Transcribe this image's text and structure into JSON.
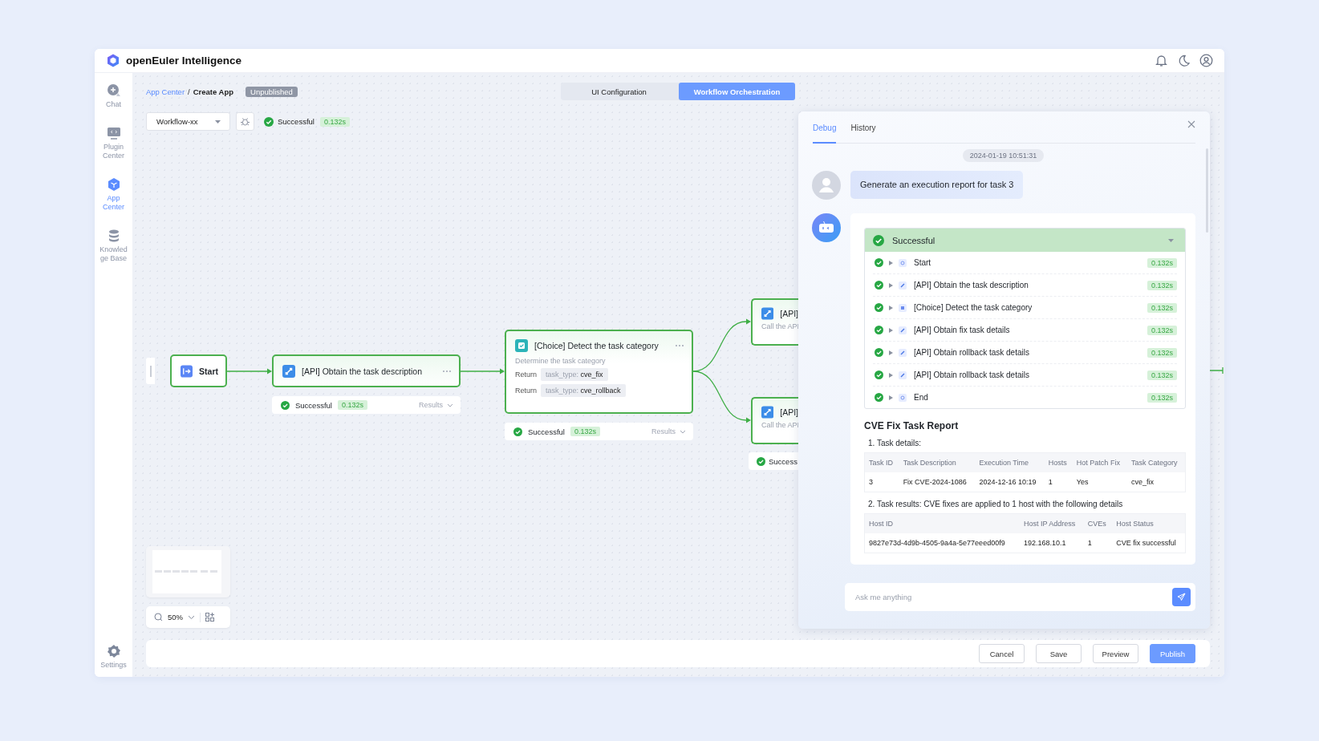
{
  "app": {
    "title": "openEuler Intelligence"
  },
  "sidebar": {
    "items": [
      {
        "label": "Chat",
        "kind": "chat",
        "selected": false
      },
      {
        "label": "Plugin Center",
        "kind": "plugin",
        "selected": false
      },
      {
        "label": "App Center",
        "kind": "app",
        "selected": true
      },
      {
        "label": "Knowledge Base",
        "kind": "knowledge",
        "selected": false
      }
    ],
    "settings": {
      "label": "Settings"
    }
  },
  "breadcrumb": {
    "items": [
      "App Center",
      "Create App"
    ],
    "separator": "/",
    "badge": "Unpublished"
  },
  "tabs": [
    {
      "label": "UI Configuration",
      "selected": false
    },
    {
      "label": "Workflow Orchestration",
      "selected": true
    }
  ],
  "toolbar": {
    "workflow": "Workflow-xx",
    "status": "Successful",
    "time": "0.132s"
  },
  "canvas": {
    "nodes": [
      {
        "kind": "start",
        "title": "Start"
      },
      {
        "kind": "api",
        "title": "[API] Obtain the task description",
        "status": {
          "text": "Successful",
          "time": "0.132s",
          "results": "Results"
        }
      },
      {
        "kind": "choice",
        "title": "[Choice] Detect the task category",
        "description": "Determine the task category",
        "returns": [
          {
            "label": "Return",
            "key": "task_type:",
            "value": "cve_fix"
          },
          {
            "label": "Return",
            "key": "task_type:",
            "value": "cve_rollback"
          }
        ],
        "status": {
          "text": "Successful",
          "time": "0.132s",
          "results": "Results"
        }
      },
      {
        "kind": "api",
        "title": "[API]",
        "description": "Call the API"
      },
      {
        "kind": "api",
        "title": "[API]",
        "description": "Call the API",
        "status": {
          "text": "Success"
        }
      }
    ],
    "zoom": "50%"
  },
  "debug_panel": {
    "tabs": [
      {
        "label": "Debug",
        "selected": true
      },
      {
        "label": "History",
        "selected": false
      }
    ],
    "timestamp": "2024-01-19 10:51:31",
    "user_message": "Generate an execution report for task 3",
    "run": {
      "status": "Successful",
      "steps": [
        {
          "kind": "start",
          "label": "Start",
          "time": "0.132s",
          "expanded": false
        },
        {
          "kind": "api",
          "label": "[API] Obtain the task description",
          "time": "0.132s",
          "expanded": false
        },
        {
          "kind": "choice",
          "label": "[Choice] Detect the task category",
          "time": "0.132s",
          "expanded": false
        },
        {
          "kind": "api",
          "label": "[API] Obtain fix task details",
          "time": "0.132s",
          "expanded": false
        },
        {
          "kind": "api",
          "label": "[API] Obtain rollback task details",
          "time": "0.132s",
          "expanded": false
        },
        {
          "kind": "api",
          "label": "[API] Obtain rollback task details",
          "time": "0.132s",
          "expanded": false
        },
        {
          "kind": "start",
          "label": "End",
          "time": "0.132s",
          "expanded": false
        }
      ]
    },
    "report": {
      "title": "CVE Fix Task Report",
      "sections": [
        {
          "heading": "1. Task details:",
          "columns": [
            "Task ID",
            "Task Description",
            "Execution Time",
            "Hosts",
            "Hot Patch Fix",
            "Task Category"
          ],
          "rows": [
            [
              "3",
              "Fix CVE-2024-1086",
              "2024-12-16 10:19",
              "1",
              "Yes",
              "cve_fix"
            ]
          ]
        },
        {
          "heading": "2. Task results: CVE fixes are applied to 1 host with the following details",
          "columns": [
            "Host ID",
            "Host IP Address",
            "CVEs",
            "Host Status"
          ],
          "rows": [
            [
              "9827e73d-4d9b-4505-9a4a-5e77eeed00f9",
              "192.168.10.1",
              "1",
              "CVE fix successful"
            ]
          ]
        }
      ]
    },
    "input": {
      "placeholder": "Ask me anything"
    }
  },
  "footer": {
    "buttons": [
      {
        "label": "Cancel",
        "kind": "default"
      },
      {
        "label": "Save",
        "kind": "default"
      },
      {
        "label": "Preview",
        "kind": "default"
      },
      {
        "label": "Publish",
        "kind": "primary"
      }
    ]
  }
}
